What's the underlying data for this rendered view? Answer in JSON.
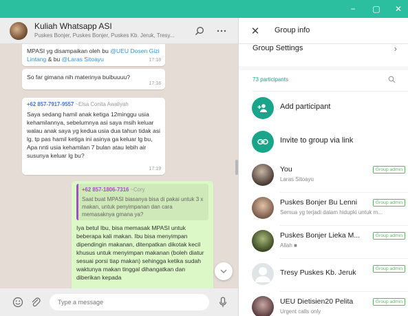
{
  "window": {
    "titlebar_color": "#2bbfa0",
    "controls": [
      "−",
      "▢",
      "✕"
    ]
  },
  "chat": {
    "title": "Kuliah Whatsapp ASI",
    "subtitle": "Puskes Bonjer, Puskes Bonjer, Puskes Kb. Jeruk, Tresy...",
    "icons": {
      "search": "search-icon",
      "menu": "more-options-icon"
    },
    "messages": [
      {
        "type": "incoming",
        "text_before": "MPASI yg disampaikan oleh bu ",
        "mention1": "@UEU Dosen Gizi Lintang",
        "text_mid": " & bu ",
        "mention2": "@Laras Sitoayu",
        "time": "17:18"
      },
      {
        "type": "incoming",
        "text": "So far gimana nih materinya buibuuuu?",
        "time": "17:18"
      },
      {
        "type": "incoming",
        "sender_number": "+62 857-7917-9557",
        "sender_name": "~Elsa Conita Awaliyah",
        "text": "Saya sedang hamil anak ketiga 12minggu usia kehamilannya, sebelumnya asi saya msih keluar walau anak saya yg kedua usia dua tahun tidak asi lg, tp pas hamil ketiga ini asinya ga keluar lg bu, Apa nnti usia kehamilan 7 bulan atau lebih air susunya keluar lg bu?",
        "time": "17:19"
      },
      {
        "type": "outgoing",
        "sender_number": "+62 857-1806-7316",
        "sender_name": "~Cory",
        "quote": "Saat buat MPASI biasanya bisa di pakai untuk 3 x makan, untuk penyimpanan dan cara memasaknya gmana ya?",
        "text": "Iya betul Ibu, bisa memasak MPASI untuk beberapa kali makan. Ibu bisa menyimpan dipendingin makanan, ditenpatkan dikotak kecil khusus untuk menyimpan makanan (boleh diatur sesuai porsi tiap makan) sehingga ketika sudah waktunya makan tinggal dihangatkan dan diberikan kepada"
      }
    ],
    "composer": {
      "placeholder": "Type a message",
      "icons": {
        "emoji": "emoji-icon",
        "attach": "paperclip-icon",
        "mic": "microphone-icon"
      }
    }
  },
  "group_info": {
    "title": "Group info",
    "settings_label": "Group Settings",
    "participants_count": "73 participants",
    "actions": [
      {
        "label": "Add participant",
        "icon": "add-person-icon"
      },
      {
        "label": "Invite to group via link",
        "icon": "link-icon"
      }
    ],
    "members": [
      {
        "name": "You",
        "status": "Laras Sitoayu",
        "badge": "Group admin"
      },
      {
        "name": "Puskes Bonjer Bu Lenni",
        "status": "Semua yg terjadi dalam hidupki untuk m...",
        "badge": "Group admin"
      },
      {
        "name": "Puskes Bonjer Lieka M...",
        "status": "Allah ■",
        "badge": "Group admin"
      },
      {
        "name": "Tresy Puskes Kb. Jeruk",
        "status": "",
        "badge": "Group admin"
      },
      {
        "name": "UEU Dietisien20 Pelita",
        "status": "Urgent calls only",
        "badge": "Group admin"
      }
    ],
    "colors": {
      "accent": "#1aa58a",
      "badge": "#4fbf5c",
      "mention": "#3a8fd0",
      "outgoing_bubble": "#dcf8c6"
    }
  }
}
